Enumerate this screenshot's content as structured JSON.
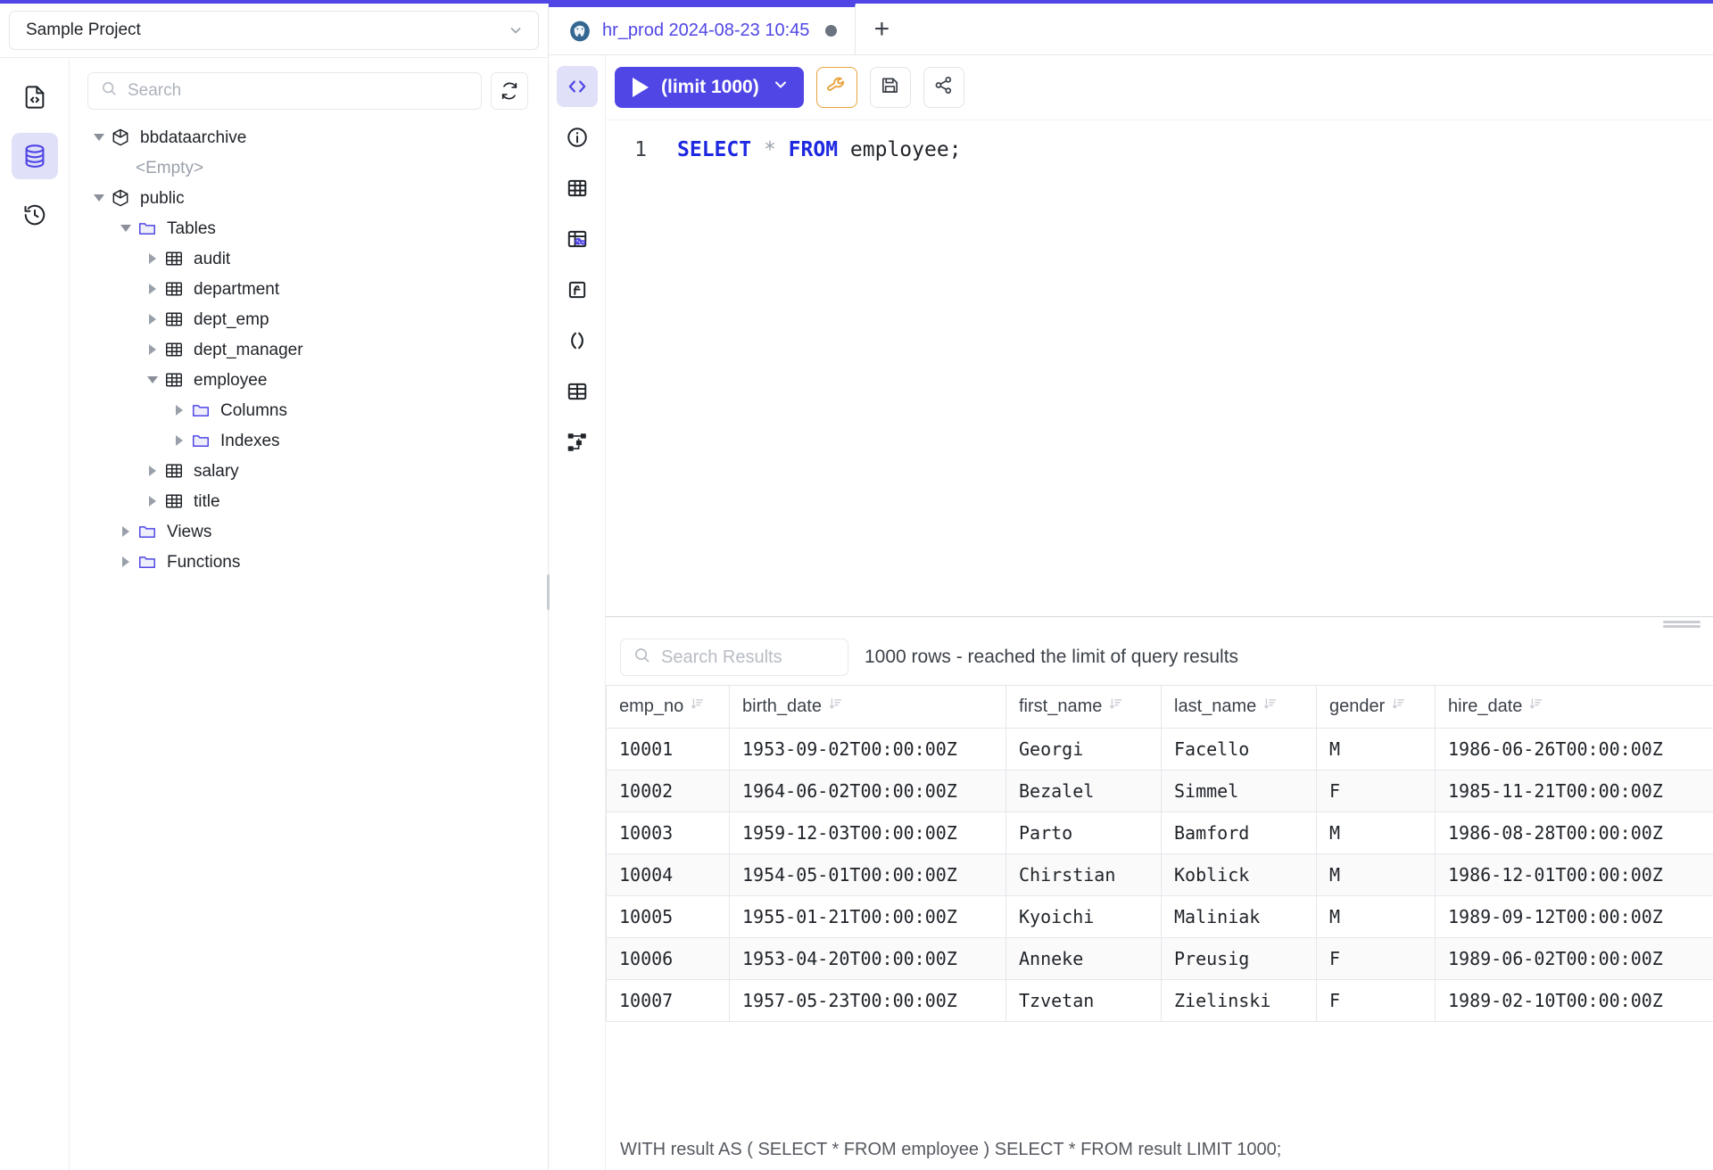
{
  "theme": {
    "accent": "#4f46e5",
    "accent_soft": "#e0e0f8",
    "warn": "#e8a33d"
  },
  "project": {
    "name": "Sample Project",
    "chevron_icon": "chevron-down-icon"
  },
  "left_rail": {
    "items": [
      {
        "icon": "file-code-icon",
        "active": false
      },
      {
        "icon": "database-icon",
        "active": true
      },
      {
        "icon": "history-icon",
        "active": false
      }
    ]
  },
  "explorer": {
    "search": {
      "placeholder": "Search",
      "value": ""
    },
    "refresh_icon": "refresh-icon",
    "tree": [
      {
        "label": "bbdataarchive",
        "icon": "schema-icon",
        "indent": 0,
        "twisty": "down"
      },
      {
        "label": "<Empty>",
        "icon": "none",
        "indent": 1,
        "twisty": "none",
        "muted": true
      },
      {
        "label": "public",
        "icon": "schema-icon",
        "indent": 0,
        "twisty": "down"
      },
      {
        "label": "Tables",
        "icon": "folder-icon",
        "indent": 1,
        "twisty": "down"
      },
      {
        "label": "audit",
        "icon": "table-icon",
        "indent": 2,
        "twisty": "right"
      },
      {
        "label": "department",
        "icon": "table-icon",
        "indent": 2,
        "twisty": "right"
      },
      {
        "label": "dept_emp",
        "icon": "table-icon",
        "indent": 2,
        "twisty": "right"
      },
      {
        "label": "dept_manager",
        "icon": "table-icon",
        "indent": 2,
        "twisty": "right"
      },
      {
        "label": "employee",
        "icon": "table-icon",
        "indent": 2,
        "twisty": "down"
      },
      {
        "label": "Columns",
        "icon": "folder-icon",
        "indent": 3,
        "twisty": "right"
      },
      {
        "label": "Indexes",
        "icon": "folder-icon",
        "indent": 3,
        "twisty": "right"
      },
      {
        "label": "salary",
        "icon": "table-icon",
        "indent": 2,
        "twisty": "right"
      },
      {
        "label": "title",
        "icon": "table-icon",
        "indent": 2,
        "twisty": "right"
      },
      {
        "label": "Views",
        "icon": "folder-icon",
        "indent": 1,
        "twisty": "right"
      },
      {
        "label": "Functions",
        "icon": "folder-icon",
        "indent": 1,
        "twisty": "right"
      }
    ]
  },
  "tabs": {
    "items": [
      {
        "icon": "postgres-icon",
        "label": "hr_prod 2024-08-23 10:45",
        "dirty": true,
        "active": true
      }
    ],
    "add_label": "+"
  },
  "editor_rail": {
    "items": [
      {
        "icon": "code-brackets-icon",
        "active": true
      },
      {
        "icon": "info-circle-icon",
        "active": false
      },
      {
        "icon": "table-grid-icon",
        "active": false
      },
      {
        "icon": "table-data-icon",
        "active": false
      },
      {
        "icon": "function-icon",
        "active": false
      },
      {
        "icon": "parentheses-icon",
        "active": false
      },
      {
        "icon": "table-grid-alt-icon",
        "active": false
      },
      {
        "icon": "schema-diagram-icon",
        "active": false
      }
    ]
  },
  "toolbar": {
    "run_label": "(limit 1000)",
    "run_play_icon": "play-icon",
    "run_chevron_icon": "chevron-down-icon",
    "format_icon": "wrench-icon",
    "save_icon": "save-icon",
    "share_icon": "share-icon"
  },
  "editor": {
    "line_number": "1",
    "tokens": [
      {
        "text": "SELECT",
        "type": "keyword"
      },
      {
        "text": " ",
        "type": "plain"
      },
      {
        "text": "*",
        "type": "operator"
      },
      {
        "text": " ",
        "type": "plain"
      },
      {
        "text": "FROM",
        "type": "keyword"
      },
      {
        "text": " ",
        "type": "plain"
      },
      {
        "text": "employee;",
        "type": "identifier"
      }
    ],
    "full_text": "SELECT * FROM employee;"
  },
  "results": {
    "search": {
      "placeholder": "Search Results",
      "value": "",
      "icon": "search-icon"
    },
    "row_count_text": "1000 rows  -  reached the limit of query results",
    "sort_icon": "sort-icon",
    "columns": [
      "emp_no",
      "birth_date",
      "first_name",
      "last_name",
      "gender",
      "hire_date"
    ],
    "rows": [
      [
        "10001",
        "1953-09-02T00:00:00Z",
        "Georgi",
        "Facello",
        "M",
        "1986-06-26T00:00:00Z"
      ],
      [
        "10002",
        "1964-06-02T00:00:00Z",
        "Bezalel",
        "Simmel",
        "F",
        "1985-11-21T00:00:00Z"
      ],
      [
        "10003",
        "1959-12-03T00:00:00Z",
        "Parto",
        "Bamford",
        "M",
        "1986-08-28T00:00:00Z"
      ],
      [
        "10004",
        "1954-05-01T00:00:00Z",
        "Chirstian",
        "Koblick",
        "M",
        "1986-12-01T00:00:00Z"
      ],
      [
        "10005",
        "1955-01-21T00:00:00Z",
        "Kyoichi",
        "Maliniak",
        "M",
        "1989-09-12T00:00:00Z"
      ],
      [
        "10006",
        "1953-04-20T00:00:00Z",
        "Anneke",
        "Preusig",
        "F",
        "1989-06-02T00:00:00Z"
      ],
      [
        "10007",
        "1957-05-23T00:00:00Z",
        "Tzvetan",
        "Zielinski",
        "F",
        "1989-02-10T00:00:00Z"
      ]
    ]
  },
  "statusbar": {
    "text": "WITH result AS ( SELECT * FROM employee ) SELECT * FROM result LIMIT 1000;"
  }
}
